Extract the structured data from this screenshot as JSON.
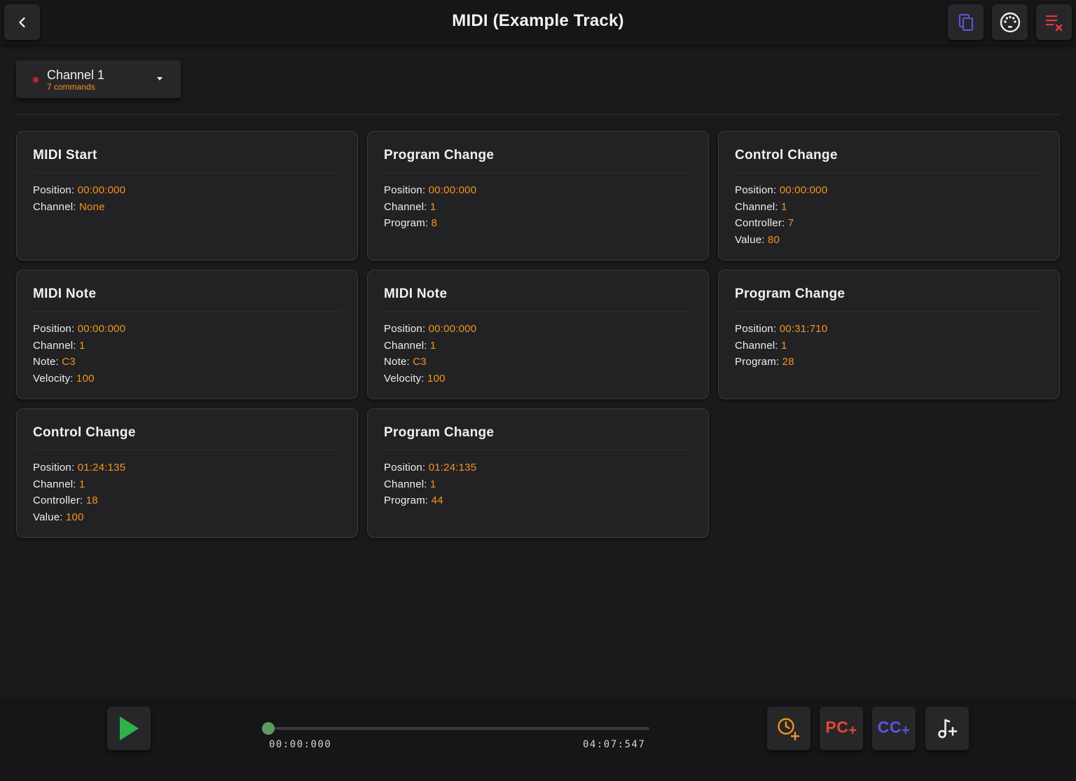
{
  "header": {
    "title": "MIDI (Example Track)",
    "icons": {
      "back": "chevron-left-icon",
      "copy": "copy-icon",
      "midi": "midi-port-icon",
      "clear": "clear-list-icon"
    }
  },
  "channel": {
    "name": "Channel 1",
    "count": "7 commands"
  },
  "labels": {
    "position": "Position: ",
    "channel": "Channel: ",
    "program": "Program: ",
    "controller": "Controller: ",
    "value": "Value: ",
    "note": "Note: ",
    "velocity": "Velocity: "
  },
  "commands": [
    {
      "title": "MIDI Start",
      "position": "00:00:000",
      "channel": "None"
    },
    {
      "title": "Program Change",
      "position": "00:00:000",
      "channel": "1",
      "program": "8"
    },
    {
      "title": "Control Change",
      "position": "00:00:000",
      "channel": "1",
      "controller": "7",
      "value": "80"
    },
    {
      "title": "MIDI Note",
      "position": "00:00:000",
      "channel": "1",
      "note": "C3",
      "velocity": "100"
    },
    {
      "title": "MIDI Note",
      "position": "00:00:000",
      "channel": "1",
      "note": "C3",
      "velocity": "100"
    },
    {
      "title": "Program Change",
      "position": "00:31:710",
      "channel": "1",
      "program": "28"
    },
    {
      "title": "Control Change",
      "position": "01:24:135",
      "channel": "1",
      "controller": "18",
      "value": "100"
    },
    {
      "title": "Program Change",
      "position": "01:24:135",
      "channel": "1",
      "program": "44"
    }
  ],
  "transport": {
    "current_time": "00:00:000",
    "end_time": "04:07:547",
    "progress": 0,
    "play_icon": "play-icon"
  },
  "add_buttons": {
    "timecode_icon": "clock-plus-icon",
    "pc_label": "PC",
    "cc_label": "CC",
    "plus": "+",
    "note_icon": "note-plus-icon"
  },
  "colors": {
    "accent": "#f3941f",
    "pc": "#e8453a",
    "cc": "#5b57e0",
    "play": "#2fb24a",
    "channel_dot": "#c0222c",
    "slider_thumb": "#5e9a62"
  }
}
